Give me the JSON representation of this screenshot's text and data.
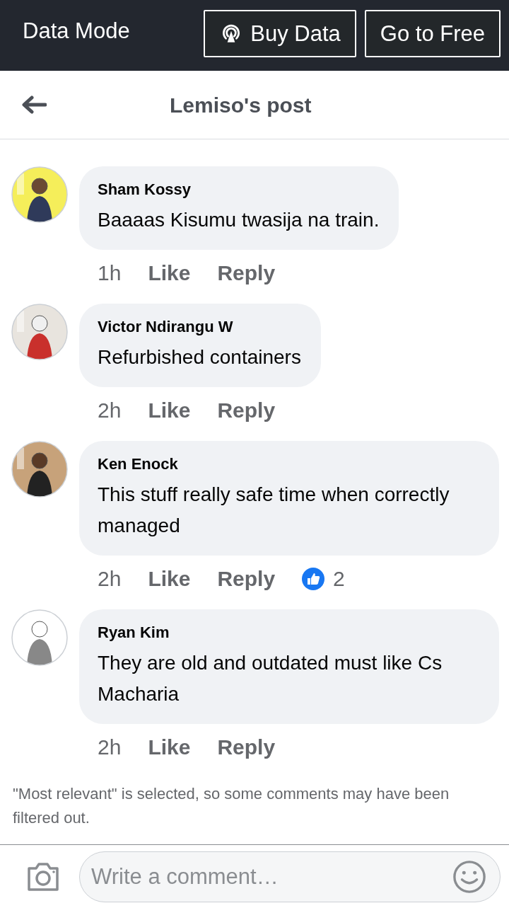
{
  "data_bar": {
    "title": "Data Mode",
    "buttons": [
      {
        "label": "Buy Data",
        "kind": "signal"
      },
      {
        "label": "Go to Free",
        "kind": "plain"
      }
    ]
  },
  "header": {
    "title": "Lemiso's post"
  },
  "comments": [
    {
      "author": "Sham Kossy",
      "text": "Baaaas Kisumu twasija na train.",
      "time": "1h",
      "actions": [
        "Like",
        "Reply"
      ]
    },
    {
      "author": "Victor Ndirangu W",
      "text": "Refurbished containers",
      "time": "2h",
      "actions": [
        "Like",
        "Reply"
      ]
    },
    {
      "author": "Ken Enock",
      "text": "This stuff really safe time when correctly managed",
      "time": "2h",
      "actions": [
        "Like",
        "Reply"
      ],
      "reactions": "2"
    },
    {
      "author": "Ryan Kim",
      "text": "They are old and outdated must like Cs Macharia",
      "time": "2h",
      "actions": [
        "Like",
        "Reply"
      ]
    }
  ],
  "filter_note": "\"Most relevant\" is selected, so some comments may have been filtered out.",
  "composer": {
    "placeholder": "Write a comment…"
  }
}
